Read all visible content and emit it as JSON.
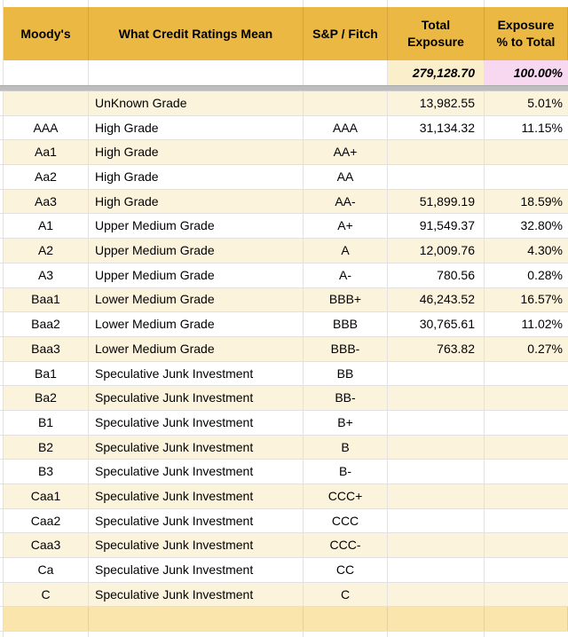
{
  "table": {
    "header": {
      "moodys": "Moody's",
      "meaning": "What Credit Ratings Mean",
      "sp_fitch": "S&P / Fitch",
      "total_exposure": "Total\nExposure",
      "exposure_pct": "Exposure\n% to Total"
    },
    "totals": {
      "total_exposure": "279,128.70",
      "exposure_pct": "100.00%"
    },
    "rows": [
      {
        "moodys": "",
        "meaning": "UnKnown Grade",
        "sp_fitch": "",
        "total_exposure": "13,982.55",
        "exposure_pct": "5.01%"
      },
      {
        "moodys": "AAA",
        "meaning": "High Grade",
        "sp_fitch": "AAA",
        "total_exposure": "31,134.32",
        "exposure_pct": "11.15%"
      },
      {
        "moodys": "Aa1",
        "meaning": "High Grade",
        "sp_fitch": "AA+",
        "total_exposure": "",
        "exposure_pct": ""
      },
      {
        "moodys": "Aa2",
        "meaning": "High Grade",
        "sp_fitch": "AA",
        "total_exposure": "",
        "exposure_pct": ""
      },
      {
        "moodys": "Aa3",
        "meaning": "High Grade",
        "sp_fitch": "AA-",
        "total_exposure": "51,899.19",
        "exposure_pct": "18.59%"
      },
      {
        "moodys": "A1",
        "meaning": "Upper Medium Grade",
        "sp_fitch": "A+",
        "total_exposure": "91,549.37",
        "exposure_pct": "32.80%"
      },
      {
        "moodys": "A2",
        "meaning": "Upper Medium Grade",
        "sp_fitch": "A",
        "total_exposure": "12,009.76",
        "exposure_pct": "4.30%"
      },
      {
        "moodys": "A3",
        "meaning": "Upper Medium Grade",
        "sp_fitch": "A-",
        "total_exposure": "780.56",
        "exposure_pct": "0.28%"
      },
      {
        "moodys": "Baa1",
        "meaning": "Lower Medium Grade",
        "sp_fitch": "BBB+",
        "total_exposure": "46,243.52",
        "exposure_pct": "16.57%"
      },
      {
        "moodys": "Baa2",
        "meaning": "Lower Medium Grade",
        "sp_fitch": "BBB",
        "total_exposure": "30,765.61",
        "exposure_pct": "11.02%"
      },
      {
        "moodys": "Baa3",
        "meaning": "Lower Medium Grade",
        "sp_fitch": "BBB-",
        "total_exposure": "763.82",
        "exposure_pct": "0.27%"
      },
      {
        "moodys": "Ba1",
        "meaning": "Speculative Junk Investment",
        "sp_fitch": "BB",
        "total_exposure": "",
        "exposure_pct": ""
      },
      {
        "moodys": "Ba2",
        "meaning": "Speculative Junk Investment",
        "sp_fitch": "BB-",
        "total_exposure": "",
        "exposure_pct": ""
      },
      {
        "moodys": "B1",
        "meaning": "Speculative Junk Investment",
        "sp_fitch": "B+",
        "total_exposure": "",
        "exposure_pct": ""
      },
      {
        "moodys": "B2",
        "meaning": "Speculative Junk Investment",
        "sp_fitch": "B",
        "total_exposure": "",
        "exposure_pct": ""
      },
      {
        "moodys": "B3",
        "meaning": "Speculative Junk Investment",
        "sp_fitch": "B-",
        "total_exposure": "",
        "exposure_pct": ""
      },
      {
        "moodys": "Caa1",
        "meaning": "Speculative Junk Investment",
        "sp_fitch": "CCC+",
        "total_exposure": "",
        "exposure_pct": ""
      },
      {
        "moodys": "Caa2",
        "meaning": "Speculative Junk Investment",
        "sp_fitch": "CCC",
        "total_exposure": "",
        "exposure_pct": ""
      },
      {
        "moodys": "Caa3",
        "meaning": "Speculative Junk Investment",
        "sp_fitch": "CCC-",
        "total_exposure": "",
        "exposure_pct": ""
      },
      {
        "moodys": "Ca",
        "meaning": "Speculative Junk Investment",
        "sp_fitch": "CC",
        "total_exposure": "",
        "exposure_pct": ""
      },
      {
        "moodys": "C",
        "meaning": "Speculative Junk Investment",
        "sp_fitch": "C",
        "total_exposure": "",
        "exposure_pct": ""
      }
    ]
  },
  "colors": {
    "header_bg": "#EBB843",
    "row_cream": "#FBF3DC",
    "row_white": "#FFFFFF",
    "total_exposure_bg": "#FBEECB",
    "total_pct_bg": "#F8D7F1",
    "footer_bg": "#FAE5AC",
    "divider_gray": "#BDBDBD",
    "gridline": "#E1E1E1"
  }
}
